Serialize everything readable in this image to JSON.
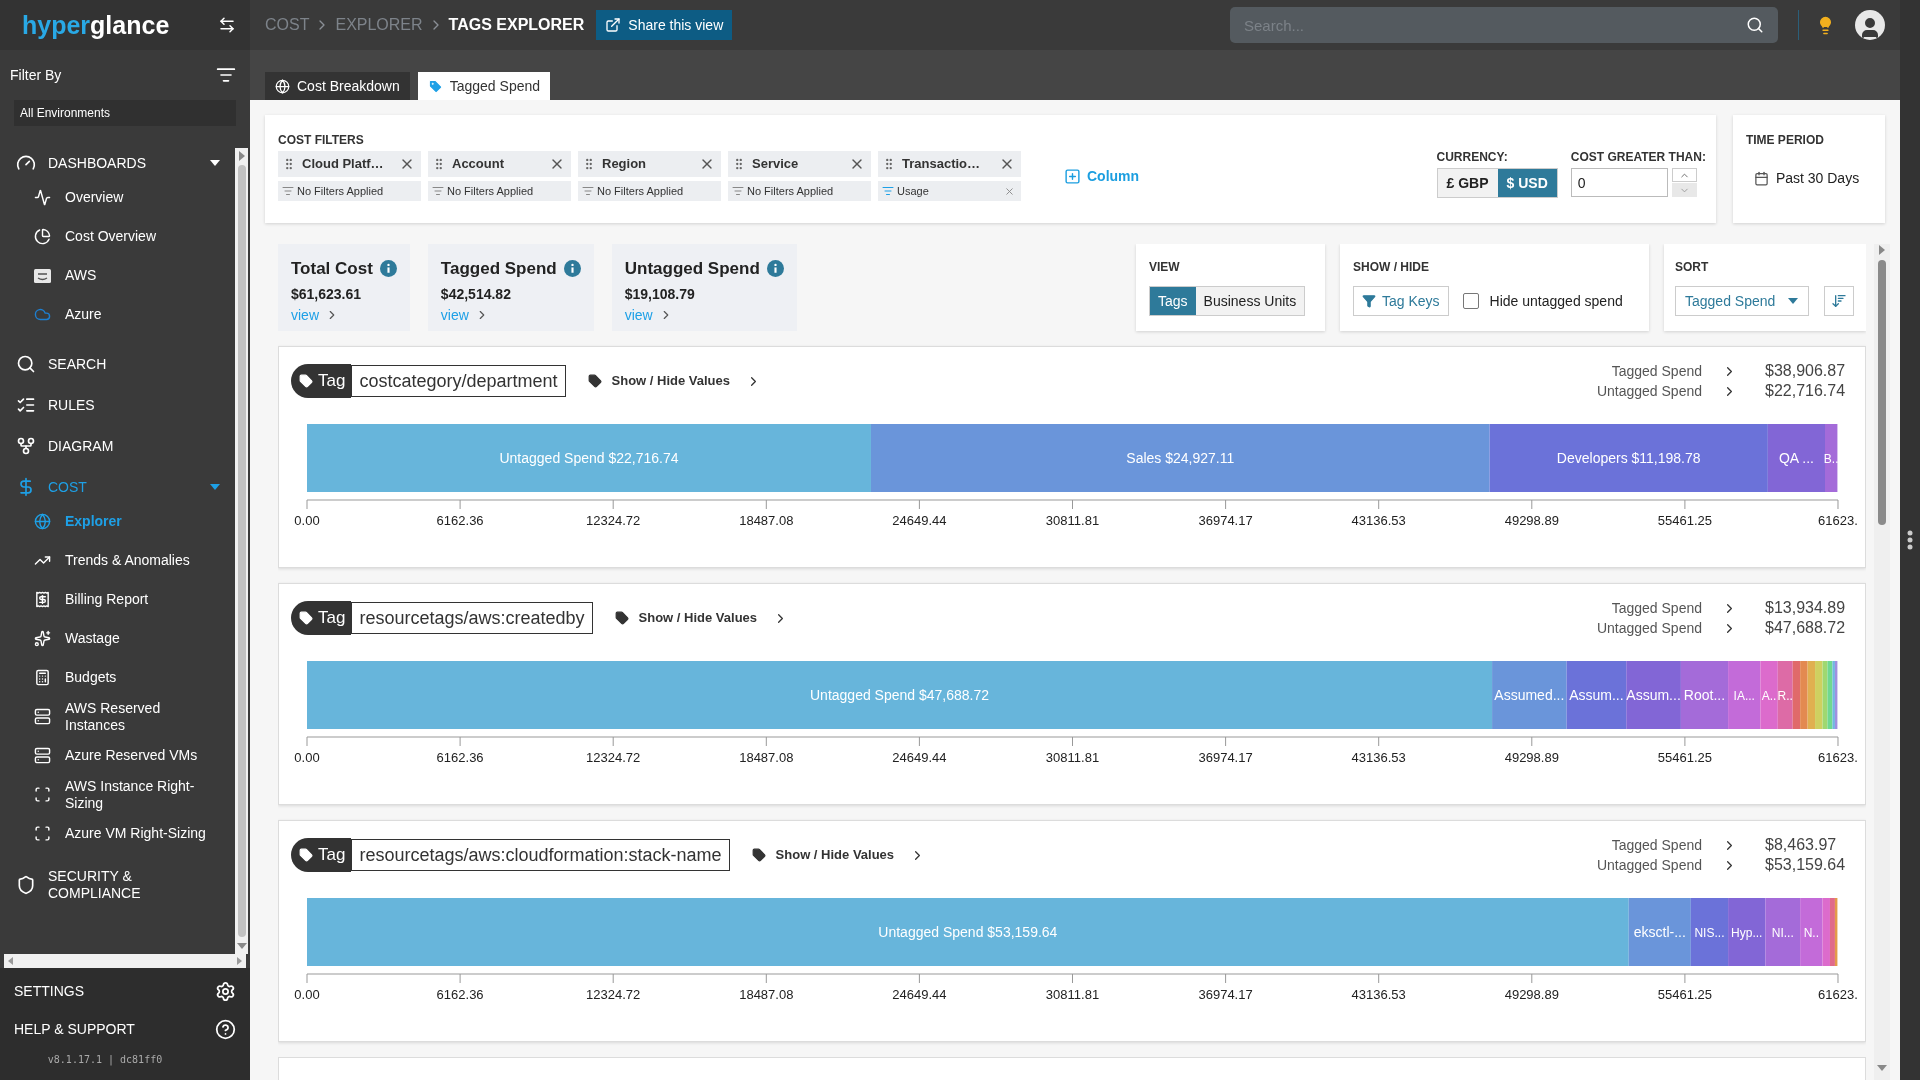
{
  "sidebar": {
    "logo_start": "hyper",
    "logo_end": "glance",
    "filter_label": "Filter By",
    "environment": "All Environments",
    "nav": [
      {
        "label": "DASHBOARDS",
        "selected": false,
        "expanded": true,
        "children": [
          {
            "label": "Overview",
            "selected": false
          },
          {
            "label": "Cost Overview",
            "selected": false
          },
          {
            "label": "AWS",
            "selected": false
          },
          {
            "label": "Azure",
            "selected": false
          }
        ]
      },
      {
        "label": "SEARCH",
        "selected": false
      },
      {
        "label": "RULES",
        "selected": false
      },
      {
        "label": "DIAGRAM",
        "selected": false
      },
      {
        "label": "COST",
        "selected": true,
        "expanded": true,
        "children": [
          {
            "label": "Explorer",
            "selected": true
          },
          {
            "label": "Trends & Anomalies",
            "selected": false
          },
          {
            "label": "Billing Report",
            "selected": false
          },
          {
            "label": "Wastage",
            "selected": false
          },
          {
            "label": "Budgets",
            "selected": false
          },
          {
            "label": "AWS Reserved Instances",
            "selected": false
          },
          {
            "label": "Azure Reserved VMs",
            "selected": false
          },
          {
            "label": "AWS Instance Right-Sizing",
            "selected": false
          },
          {
            "label": "Azure VM Right-Sizing",
            "selected": false
          }
        ]
      },
      {
        "label": "SECURITY & COMPLIANCE",
        "selected": false
      }
    ],
    "footer": [
      {
        "label": "SETTINGS"
      },
      {
        "label": "HELP & SUPPORT"
      }
    ],
    "version": "v8.1.17.1 | dc81ff0"
  },
  "breadcrumbs": [
    {
      "label": "COST",
      "current": false
    },
    {
      "label": "EXPLORER",
      "current": false
    },
    {
      "label": "TAGS EXPLORER",
      "current": true
    }
  ],
  "share_button": "Share this view",
  "search": {
    "placeholder": "Search..."
  },
  "tabs": [
    {
      "label": "Cost Breakdown",
      "selected": false
    },
    {
      "label": "Tagged Spend",
      "selected": true
    }
  ],
  "cost_filters": {
    "title": "COST FILTERS",
    "add_column": "Column",
    "items": [
      {
        "name": "Cloud Platf…",
        "filter": "No Filters Applied",
        "applied": false
      },
      {
        "name": "Account",
        "filter": "No Filters Applied",
        "applied": false
      },
      {
        "name": "Region",
        "filter": "No Filters Applied",
        "applied": false
      },
      {
        "name": "Service",
        "filter": "No Filters Applied",
        "applied": false
      },
      {
        "name": "Transactio…",
        "filter": "Usage",
        "applied": true
      }
    ]
  },
  "currency": {
    "label": "CURRENCY:",
    "options": [
      {
        "label": "£ GBP",
        "selected": false
      },
      {
        "label": "$ USD",
        "selected": true
      }
    ]
  },
  "cost_greater_than": {
    "label": "COST GREATER THAN:",
    "value": "0"
  },
  "time_period": {
    "title": "TIME PERIOD",
    "value": "Past 30 Days"
  },
  "summary": [
    {
      "title": "Total Cost",
      "value": "$61,623.61",
      "link": "view"
    },
    {
      "title": "Tagged Spend",
      "value": "$42,514.82",
      "link": "view"
    },
    {
      "title": "Untagged Spend",
      "value": "$19,108.79",
      "link": "view"
    }
  ],
  "view": {
    "title": "VIEW",
    "options": [
      {
        "label": "Tags",
        "selected": true
      },
      {
        "label": "Business Units",
        "selected": false
      }
    ]
  },
  "show_hide": {
    "title": "SHOW / HIDE",
    "tag_keys": "Tag Keys",
    "hide_untagged": {
      "label": "Hide untagged spend",
      "checked": false
    }
  },
  "sort": {
    "title": "SORT",
    "value": "Tagged Spend"
  },
  "tag_cards": [
    {
      "badge": "Tag",
      "tag": "costcategory/department",
      "toggle": "Show / Hide Values",
      "totals": [
        {
          "label": "Tagged Spend",
          "value": "$38,906.87"
        },
        {
          "label": "Untagged Spend",
          "value": "$22,716.74"
        }
      ],
      "chart_data": {
        "type": "bar",
        "orientation": "horizontal",
        "stacked": true,
        "xlim": [
          0,
          61623.61
        ],
        "xticks": [
          {
            "value": 0,
            "label": "0.00"
          },
          {
            "value": 6162.36,
            "label": "6162.36"
          },
          {
            "value": 12324.72,
            "label": "12324.72"
          },
          {
            "value": 18487.08,
            "label": "18487.08"
          },
          {
            "value": 24649.44,
            "label": "24649.44"
          },
          {
            "value": 30811.81,
            "label": "30811.81"
          },
          {
            "value": 36974.17,
            "label": "36974.17"
          },
          {
            "value": 43136.53,
            "label": "43136.53"
          },
          {
            "value": 49298.89,
            "label": "49298.89"
          },
          {
            "value": 55461.25,
            "label": "55461.25"
          },
          {
            "value": 61623,
            "label": "61623."
          }
        ],
        "series": [
          {
            "name": "Untagged Spend $22,716.74",
            "color": "#67b5db",
            "values": [
              22700
            ]
          },
          {
            "name": "Sales $24,927.11",
            "color": "#6a95da",
            "values": [
              24900
            ]
          },
          {
            "name": "Developers $11,198.78",
            "color": "#6b72d9",
            "values": [
              11200
            ]
          },
          {
            "name": "QA ...",
            "color": "#8266d6",
            "values": [
              2300
            ]
          },
          {
            "name": "B..",
            "color": "#a46bd9",
            "values": [
              500
            ]
          }
        ]
      }
    },
    {
      "badge": "Tag",
      "tag": "resourcetags/aws:createdby",
      "toggle": "Show / Hide Values",
      "totals": [
        {
          "label": "Tagged Spend",
          "value": "$13,934.89"
        },
        {
          "label": "Untagged Spend",
          "value": "$47,688.72"
        }
      ],
      "chart_data": {
        "type": "bar",
        "orientation": "horizontal",
        "stacked": true,
        "xlim": [
          0,
          61623.61
        ],
        "xticks": [
          {
            "value": 0,
            "label": "0.00"
          },
          {
            "value": 6162.36,
            "label": "6162.36"
          },
          {
            "value": 12324.72,
            "label": "12324.72"
          },
          {
            "value": 18487.08,
            "label": "18487.08"
          },
          {
            "value": 24649.44,
            "label": "24649.44"
          },
          {
            "value": 30811.81,
            "label": "30811.81"
          },
          {
            "value": 36974.17,
            "label": "36974.17"
          },
          {
            "value": 43136.53,
            "label": "43136.53"
          },
          {
            "value": 49298.89,
            "label": "49298.89"
          },
          {
            "value": 55461.25,
            "label": "55461.25"
          },
          {
            "value": 61623,
            "label": "61623."
          }
        ],
        "series": [
          {
            "name": "Untagged Spend $47,688.72",
            "color": "#67b5db",
            "values": [
              47700
            ]
          },
          {
            "name": "Assumed...",
            "color": "#6a95da",
            "values": [
              3000
            ]
          },
          {
            "name": "Assum...",
            "color": "#6b72d9",
            "values": [
              2400
            ]
          },
          {
            "name": "Assum...",
            "color": "#8266d6",
            "values": [
              2200
            ]
          },
          {
            "name": "Root...",
            "color": "#a46bd9",
            "values": [
              1900
            ]
          },
          {
            "name": "IA...",
            "color": "#c36bd9",
            "values": [
              1300
            ]
          },
          {
            "name": "A..",
            "color": "#dc6bcc",
            "values": [
              700
            ]
          },
          {
            "name": "R..",
            "color": "#dd6ba6",
            "values": [
              600
            ]
          },
          {
            "color": "#e06a6a",
            "values": [
              300
            ]
          },
          {
            "color": "#e38a50",
            "values": [
              300
            ]
          },
          {
            "color": "#e0b050",
            "values": [
              300
            ]
          },
          {
            "color": "#cfd060",
            "values": [
              300
            ]
          },
          {
            "color": "#a0d870",
            "values": [
              200
            ]
          },
          {
            "color": "#70d890",
            "values": [
              200
            ]
          },
          {
            "color": "#70b8e0",
            "values": [
              100
            ]
          },
          {
            "color": "#a090e0",
            "values": [
              100
            ]
          }
        ]
      }
    },
    {
      "badge": "Tag",
      "tag": "resourcetags/aws:cloudformation:stack-name",
      "toggle": "Show / Hide Values",
      "totals": [
        {
          "label": "Tagged Spend",
          "value": "$8,463.97"
        },
        {
          "label": "Untagged Spend",
          "value": "$53,159.64"
        }
      ],
      "chart_data": {
        "type": "bar",
        "orientation": "horizontal",
        "stacked": true,
        "xlim": [
          0,
          61623.61
        ],
        "xticks": [
          {
            "value": 0,
            "label": "0.00"
          },
          {
            "value": 6162.36,
            "label": "6162.36"
          },
          {
            "value": 12324.72,
            "label": "12324.72"
          },
          {
            "value": 18487.08,
            "label": "18487.08"
          },
          {
            "value": 24649.44,
            "label": "24649.44"
          },
          {
            "value": 30811.81,
            "label": "30811.81"
          },
          {
            "value": 36974.17,
            "label": "36974.17"
          },
          {
            "value": 43136.53,
            "label": "43136.53"
          },
          {
            "value": 49298.89,
            "label": "49298.89"
          },
          {
            "value": 55461.25,
            "label": "55461.25"
          },
          {
            "value": 61623,
            "label": "61623."
          }
        ],
        "series": [
          {
            "name": "Untagged Spend $53,159.64",
            "color": "#67b5db",
            "values": [
              53200
            ]
          },
          {
            "name": "eksctl-...",
            "color": "#6a95da",
            "values": [
              2500
            ]
          },
          {
            "name": "NIS...",
            "color": "#6b72d9",
            "values": [
              1500
            ]
          },
          {
            "name": "Hyp...",
            "color": "#8266d6",
            "values": [
              1500
            ]
          },
          {
            "name": "NI...",
            "color": "#a46bd9",
            "values": [
              1400
            ]
          },
          {
            "name": "N..",
            "color": "#c36bd9",
            "values": [
              900
            ]
          },
          {
            "color": "#dc6bcc",
            "values": [
              300
            ]
          },
          {
            "color": "#e06a8a",
            "values": [
              200
            ]
          },
          {
            "color": "#e39a4a",
            "values": [
              100
            ]
          }
        ]
      }
    }
  ]
}
